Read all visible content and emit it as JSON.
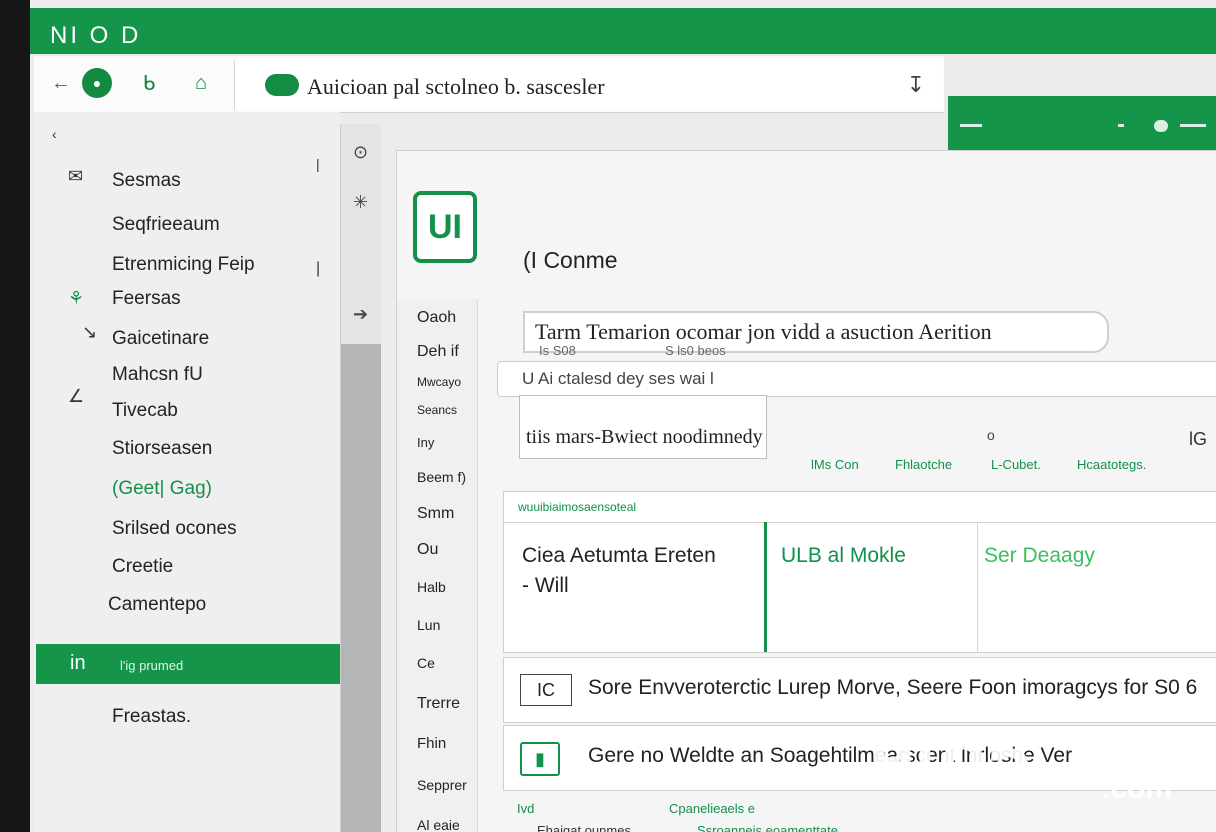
{
  "app": {
    "title": "NI O D"
  },
  "toolbar": {
    "back_icon": "←",
    "home_icon": "●",
    "bookmark_icon": "ᑲ",
    "tab_icon": "⌂"
  },
  "address": {
    "text": "Auicioan pal sctolneo b. sascesler",
    "end_icon": "↧"
  },
  "sidebar": {
    "collapse": "‹",
    "items": [
      {
        "label": "Sesmas",
        "icon": "✉"
      },
      {
        "label": "Seqfrieeaum",
        "icon": ""
      },
      {
        "label": "Etrenmicing Feip",
        "icon": ""
      },
      {
        "label": "Feersas",
        "icon": "⚘"
      },
      {
        "label": "Gaicetinare",
        "icon": "↘"
      },
      {
        "label": "Mahcsn fU",
        "icon": ""
      },
      {
        "label": "Tivecab",
        "icon": "∠"
      },
      {
        "label": "Stiorseasen",
        "icon": ""
      },
      {
        "label": "(Geet| Gag)",
        "icon": ""
      },
      {
        "label": "Srilsed ocones",
        "icon": ""
      },
      {
        "label": "Creetie",
        "icon": ""
      },
      {
        "label": "Camentepo",
        "icon": ""
      },
      {
        "label": "Freastas.",
        "icon": ""
      }
    ],
    "active": {
      "label": "in",
      "sub": "l'ig prumed"
    },
    "marker": "|"
  },
  "rail": {
    "icons": [
      "⊙",
      "✳",
      "➔"
    ]
  },
  "main": {
    "brand": "UI",
    "title": "(I Conme",
    "subnav": [
      "Oaoh",
      "Deh if",
      "Mwcayo",
      "Seancs",
      "Iny",
      "Beem f)",
      "Smm",
      "Ou",
      "Halb",
      "Lun",
      "Ce",
      "Trerre",
      "Fhin",
      "Sepprer",
      "Al eaie"
    ],
    "description": "Tarm Temarion ocomar jon vidd a asuction Aerition",
    "desc_meta": [
      "Is S08",
      "S ls0 beos"
    ],
    "search": "U Ai ctalesd dey ses wai l",
    "mode": "tiis mars-Bwiect noodimnedy",
    "circle": "o",
    "right_icon": "lG",
    "pills": [
      "lMs Con",
      "Fhlaotche",
      "L-Cubet.",
      "Hcaatotegs."
    ],
    "cards_label": "wuuibiaimosaensoteal",
    "cards": [
      {
        "title": "Ciea Aetumta Ereten",
        "sub": "- Will",
        "color": "#222222"
      },
      {
        "title": "ULB al Mokle",
        "sub": "",
        "color": "#13904a"
      },
      {
        "title": "Ser Deaagy",
        "sub": "",
        "color": "#3bbf5c"
      }
    ],
    "rows": [
      {
        "badge": "IC",
        "text": "Sore Envveroterctic Lurep Morve, Seere Foon imoragcys for S0 6"
      },
      {
        "badge": "▮",
        "text": "Gere no Weldte an Soagehtilmearscent lnrloshe Ver"
      }
    ],
    "footer": [
      "Ivd",
      "Cpanelieaels e",
      "Ehaigat ounmes",
      "Ssroanneis eoamenttate"
    ]
  },
  "watermark": {
    "text": "9to5",
    "suffix": ".com"
  }
}
